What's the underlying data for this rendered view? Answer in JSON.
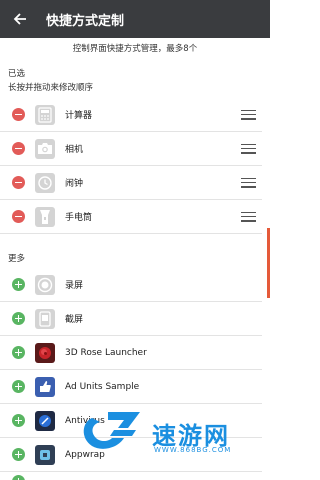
{
  "header": {
    "title": "快捷方式定制"
  },
  "subtitle": "控制界面快捷方式管理，最多8个",
  "selected": {
    "heading": "已选",
    "hint": "长按并拖动来修改顺序",
    "items": [
      {
        "label": "计算器",
        "icon": "calculator-icon"
      },
      {
        "label": "相机",
        "icon": "camera-icon"
      },
      {
        "label": "闹钟",
        "icon": "alarm-icon"
      },
      {
        "label": "手电筒",
        "icon": "flashlight-icon"
      }
    ]
  },
  "more": {
    "heading": "更多",
    "items": [
      {
        "label": "录屏",
        "icon": "screen-record-icon"
      },
      {
        "label": "截屏",
        "icon": "screenshot-icon"
      },
      {
        "label": "3D Rose Launcher",
        "icon": "rose-launcher-icon"
      },
      {
        "label": "Ad Units Sample",
        "icon": "ad-units-icon"
      },
      {
        "label": "Antivirus",
        "icon": "antivirus-icon"
      },
      {
        "label": "Appwrap",
        "icon": "appwrap-icon"
      }
    ]
  },
  "watermark": {
    "text": "速游网",
    "url": "WWW.868BG.COM"
  },
  "colors": {
    "appbar": "#3a3c3f",
    "remove": "#e25b58",
    "add": "#59b562",
    "accent": "#e55a3a",
    "watermark": "#1b8fe0"
  }
}
